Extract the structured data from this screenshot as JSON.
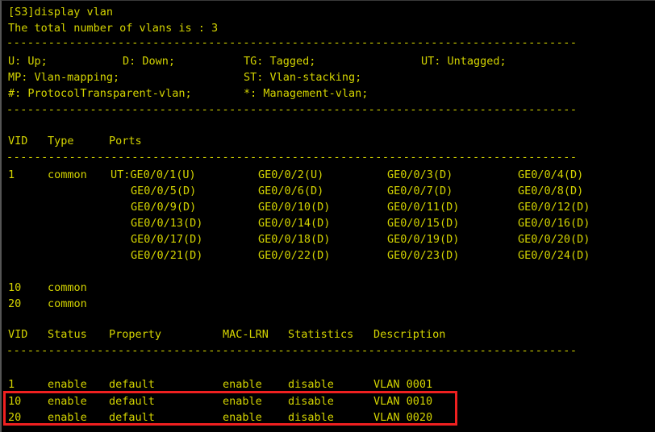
{
  "terminal": {
    "prompt_line": "[S3]display vlan",
    "total_line": "The total number of vlans is : 3",
    "separator": "----------------------------------------------------------------------------------",
    "legend": [
      {
        "c1": "U: Up;",
        "c2": "D: Down;",
        "c3": "TG: Tagged;",
        "c4": "UT: Untagged;"
      },
      {
        "c1": "MP: Vlan-mapping;",
        "c2": "",
        "c3": "ST: Vlan-stacking;",
        "c4": ""
      },
      {
        "c1": "#: ProtocolTransparent-vlan;",
        "c2": "",
        "c3": "*: Management-vlan;",
        "c4": ""
      }
    ],
    "ports_table": {
      "headers": {
        "vid": "VID",
        "type": "Type",
        "ports": "Ports"
      },
      "rows": [
        {
          "vid": "1",
          "type": "common",
          "port_rows": [
            [
              "UT:GE0/0/1(U)",
              "GE0/0/2(U)",
              "GE0/0/3(D)",
              "GE0/0/4(D)"
            ],
            [
              "GE0/0/5(D)",
              "GE0/0/6(D)",
              "GE0/0/7(D)",
              "GE0/0/8(D)"
            ],
            [
              "GE0/0/9(D)",
              "GE0/0/10(D)",
              "GE0/0/11(D)",
              "GE0/0/12(D)"
            ],
            [
              "GE0/0/13(D)",
              "GE0/0/14(D)",
              "GE0/0/15(D)",
              "GE0/0/16(D)"
            ],
            [
              "GE0/0/17(D)",
              "GE0/0/18(D)",
              "GE0/0/19(D)",
              "GE0/0/20(D)"
            ],
            [
              "GE0/0/21(D)",
              "GE0/0/22(D)",
              "GE0/0/23(D)",
              "GE0/0/24(D)"
            ]
          ]
        },
        {
          "vid": "10",
          "type": "common",
          "port_rows": []
        },
        {
          "vid": "20",
          "type": "common",
          "port_rows": []
        }
      ]
    },
    "status_table": {
      "headers": {
        "vid": "VID",
        "status": "Status",
        "property": "Property",
        "mac_lrn": "MAC-LRN",
        "statistics": "Statistics",
        "description": "Description"
      },
      "rows": [
        {
          "vid": "1",
          "status": "enable",
          "property": "default",
          "mac_lrn": "enable",
          "statistics": "disable",
          "description": "VLAN 0001",
          "highlighted": false
        },
        {
          "vid": "10",
          "status": "enable",
          "property": "default",
          "mac_lrn": "enable",
          "statistics": "disable",
          "description": "VLAN 0010",
          "highlighted": true
        },
        {
          "vid": "20",
          "status": "enable",
          "property": "default",
          "mac_lrn": "enable",
          "statistics": "disable",
          "description": "VLAN 0020",
          "highlighted": true
        }
      ]
    },
    "colors": {
      "text": "#d4d400",
      "background": "#000000",
      "annotation": "#ef2020"
    }
  }
}
